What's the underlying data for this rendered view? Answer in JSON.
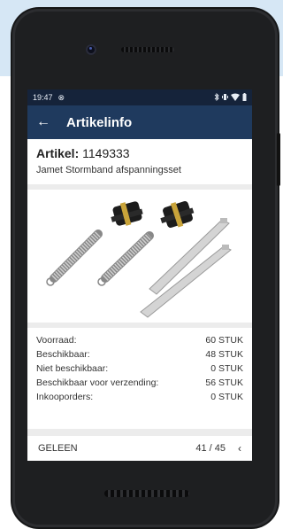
{
  "statusbar": {
    "time": "19:47",
    "notification_icon": "sync-icon",
    "right_icons": [
      "bluetooth-icon",
      "vibrate-icon",
      "wifi-icon",
      "battery-icon"
    ]
  },
  "appbar": {
    "back_icon": "arrow-left-icon",
    "title": "Artikelinfo"
  },
  "article": {
    "label": "Artikel:",
    "number": "1149333",
    "description": "Jamet Stormband afspanningsset"
  },
  "stock": [
    {
      "label": "Voorraad:",
      "value": "60 STUK"
    },
    {
      "label": "Beschikbaar:",
      "value": "48 STUK"
    },
    {
      "label": "Niet beschikbaar:",
      "value": "0 STUK"
    },
    {
      "label": "Beschikbaar voor verzending:",
      "value": "56 STUK"
    },
    {
      "label": "Inkooporders:",
      "value": "0 STUK"
    }
  ],
  "pager": {
    "left_label": "GELEEN",
    "position": "41 / 45",
    "prev_icon": "chevron-left-icon"
  },
  "colors": {
    "statusbar": "#15233a",
    "appbar": "#1f3a5e",
    "background_band": "#d6e7f5",
    "device": "#1e1f21"
  }
}
